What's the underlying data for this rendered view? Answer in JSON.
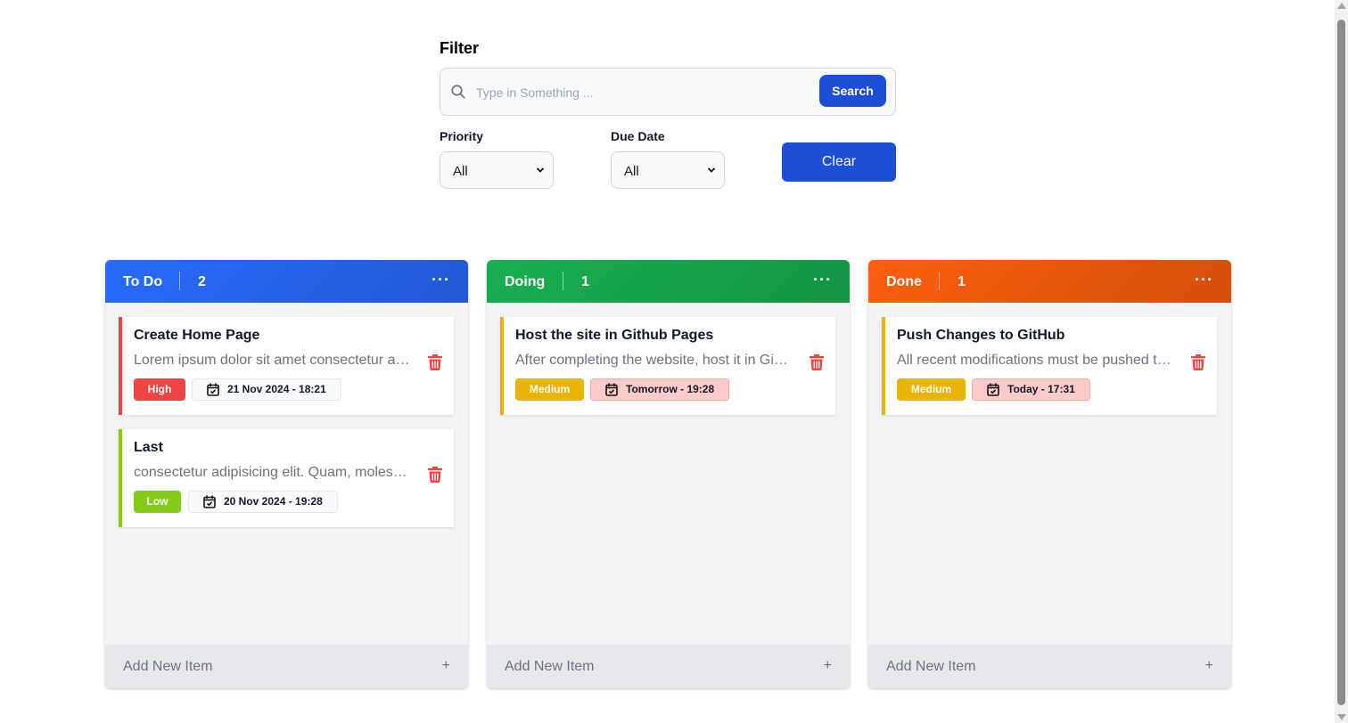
{
  "filter": {
    "title": "Filter",
    "search_placeholder": "Type in Something ...",
    "search_label": "Search",
    "priority_label": "Priority",
    "priority_value": "All",
    "due_label": "Due Date",
    "due_value": "All",
    "clear_label": "Clear"
  },
  "columns": [
    {
      "title": "To Do",
      "count": "2",
      "color": "#2563eb",
      "add_label": "Add New Item",
      "cards": [
        {
          "title": "Create Home Page",
          "desc": "Lorem ipsum dolor sit amet consectetur adipisicing elit",
          "priority": "High",
          "priority_color": "#ef4444",
          "date": "21 Nov 2024 - 18:21",
          "urgent": false
        },
        {
          "title": "Last",
          "desc": "consectetur adipisicing elit. Quam, molestias",
          "priority": "Low",
          "priority_color": "#84cc16",
          "date": "20 Nov 2024 - 19:28",
          "urgent": false
        }
      ]
    },
    {
      "title": "Doing",
      "count": "1",
      "color": "#16a34a",
      "add_label": "Add New Item",
      "cards": [
        {
          "title": "Host the site in Github Pages",
          "desc": "After completing the website, host it in Github Pages",
          "priority": "Medium",
          "priority_color": "#eab308",
          "date": "Tomorrow - 19:28",
          "urgent": true
        }
      ]
    },
    {
      "title": "Done",
      "count": "1",
      "color": "#ea580c",
      "add_label": "Add New Item",
      "cards": [
        {
          "title": "Push Changes to GitHub",
          "desc": "All recent modifications must be pushed to GitHub",
          "priority": "Medium",
          "priority_color": "#eab308",
          "date": "Today - 17:31",
          "urgent": true
        }
      ]
    }
  ]
}
